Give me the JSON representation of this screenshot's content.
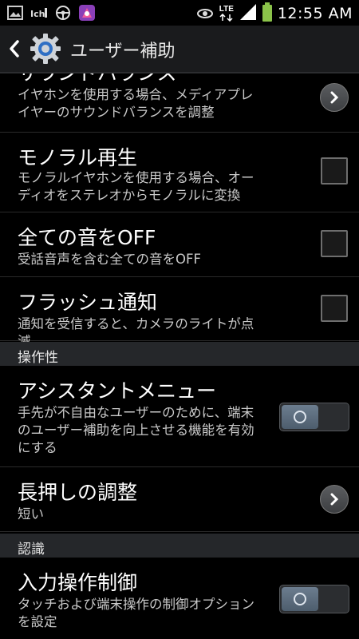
{
  "status_bar": {
    "time": "12:55 AM",
    "network": "LTE",
    "icons": [
      "picture-icon",
      "signal-app-icon",
      "steering-icon",
      "app-icon",
      "eye-icon",
      "lte-icon",
      "signal-bars-icon",
      "battery-icon"
    ]
  },
  "action_bar": {
    "title": "ユーザー補助",
    "icons": [
      "back-icon",
      "settings-gear-icon"
    ]
  },
  "items": [
    {
      "title": "サウンドバランス",
      "subtitle": "イヤホンを使用する場合、メディアプレイヤーのサウンドバランスを調整",
      "control": "chevron"
    },
    {
      "title": "モノラル再生",
      "subtitle": "モノラルイヤホンを使用する場合、オーディオをステレオからモノラルに変換",
      "control": "checkbox"
    },
    {
      "title": "全ての音をOFF",
      "subtitle": "受話音声を含む全ての音をOFF",
      "control": "checkbox"
    },
    {
      "title": "フラッシュ通知",
      "subtitle": "通知を受信すると、カメラのライトが点滅",
      "control": "checkbox"
    },
    {
      "title": "アシスタントメニュー",
      "subtitle": "手先が不自由なユーザーのために、端末のユーザー補助を向上させる機能を有効にする",
      "control": "toggle"
    },
    {
      "title": "長押しの調整",
      "subtitle": "短い",
      "control": "chevron"
    },
    {
      "title": "入力操作制御",
      "subtitle": "タッチおよび端末操作の制御オプションを設定",
      "control": "toggle"
    }
  ],
  "sections": [
    {
      "label": "操作性"
    },
    {
      "label": "認識"
    }
  ],
  "colors": {
    "background": "#000000",
    "action_bar": "#1a1b1d",
    "section_header": "#25272a",
    "toggle_knob": "#5d6e7f"
  }
}
